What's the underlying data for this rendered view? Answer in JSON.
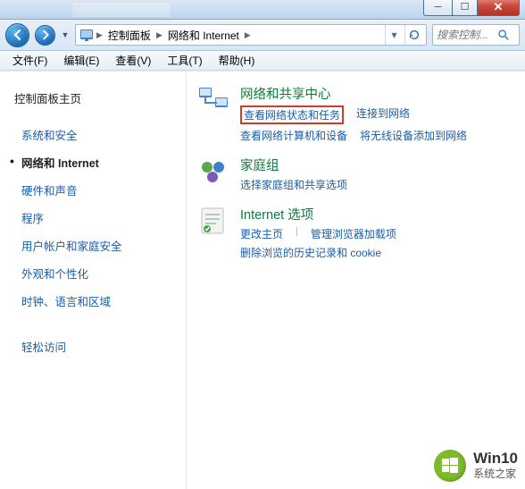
{
  "breadcrumb": {
    "root_icon": "control-panel-icon",
    "parts": [
      "控制面板",
      "网络和 Internet"
    ]
  },
  "search": {
    "placeholder": "搜索控制..."
  },
  "menus": {
    "file": "文件(F)",
    "edit": "编辑(E)",
    "view": "查看(V)",
    "tools": "工具(T)",
    "help": "帮助(H)"
  },
  "sidebar": {
    "home": "控制面板主页",
    "items": [
      "系统和安全",
      "网络和 Internet",
      "硬件和声音",
      "程序",
      "用户帐户和家庭安全",
      "外观和个性化",
      "时钟、语言和区域",
      "轻松访问"
    ],
    "active_index": 1
  },
  "sections": [
    {
      "title": "网络和共享中心",
      "links": [
        {
          "text": "查看网络状态和任务",
          "highlighted": true
        },
        {
          "text": "连接到网络"
        },
        {
          "text": "查看网络计算机和设备"
        },
        {
          "text": "将无线设备添加到网络"
        }
      ]
    },
    {
      "title": "家庭组",
      "links": [
        {
          "text": "选择家庭组和共享选项"
        }
      ]
    },
    {
      "title": "Internet 选项",
      "links": [
        {
          "text": "更改主页"
        },
        {
          "divider": "|"
        },
        {
          "text": "管理浏览器加载项"
        },
        {
          "text": "删除浏览的历史记录和 cookie"
        }
      ]
    }
  ],
  "watermark": {
    "line1": "Win10",
    "line2": "系统之家"
  }
}
